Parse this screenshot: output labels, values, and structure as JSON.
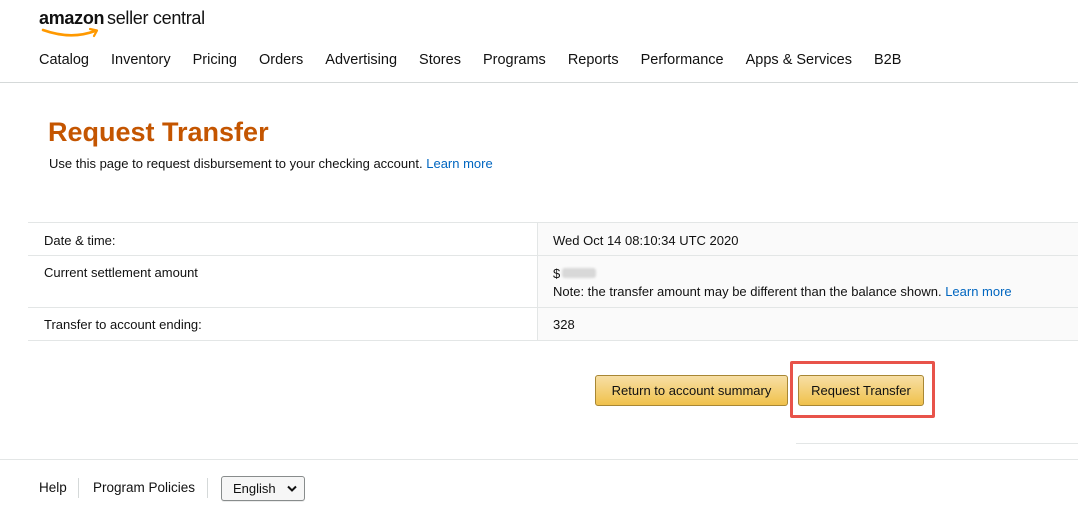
{
  "logo": {
    "word1": "amazon",
    "word2": "seller central"
  },
  "nav": [
    "Catalog",
    "Inventory",
    "Pricing",
    "Orders",
    "Advertising",
    "Stores",
    "Programs",
    "Reports",
    "Performance",
    "Apps & Services",
    "B2B"
  ],
  "page": {
    "title": "Request Transfer",
    "subtitle": "Use this page to request disbursement to your checking account.",
    "learn_more": "Learn more"
  },
  "table": {
    "date_label": "Date & time:",
    "date_value": "Wed Oct 14 08:10:34 UTC 2020",
    "amount_label": "Current settlement amount",
    "amount_prefix": "$",
    "amount_note": "Note: the transfer amount may be different than the balance shown.",
    "amount_learn_more": "Learn more",
    "account_label": "Transfer to account ending:",
    "account_value": "328"
  },
  "buttons": {
    "return": "Return to account summary",
    "request": "Request Transfer"
  },
  "footer": {
    "help": "Help",
    "policies": "Program Policies",
    "language": "English"
  },
  "colors": {
    "title": "#c45500",
    "link": "#0066c0",
    "button": "#f0c14b",
    "highlight": "#e8534a"
  }
}
